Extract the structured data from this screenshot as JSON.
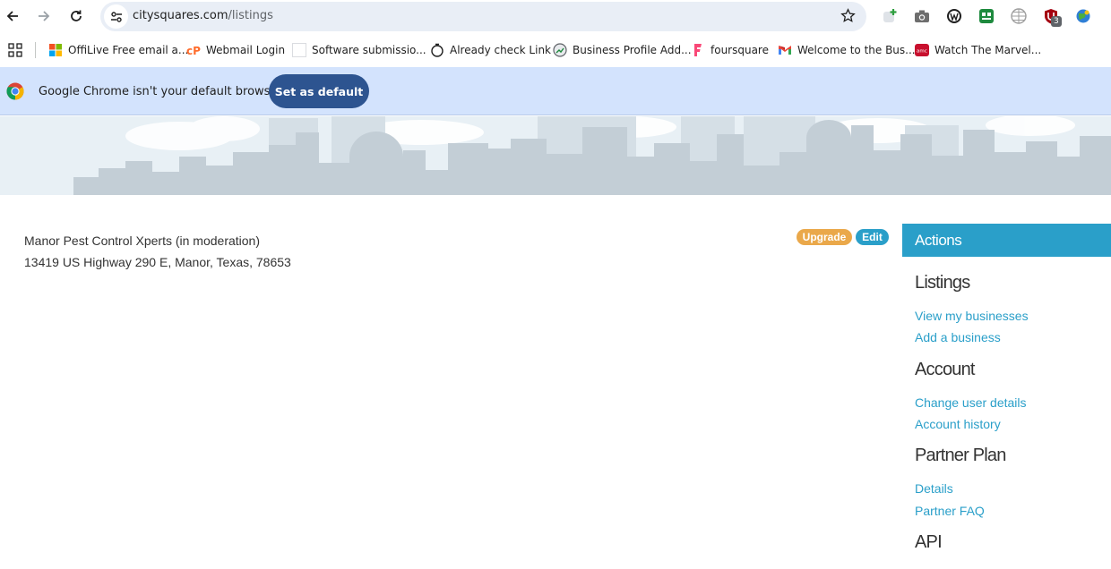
{
  "browser": {
    "url_host": "citysquares.com",
    "url_path": "/listings",
    "bookmarks": [
      {
        "label": "OffiLive Free email a...",
        "icon": "windows-logo-icon"
      },
      {
        "label": "Webmail Login",
        "icon": "cpanel-icon"
      },
      {
        "label": "Software submissio...",
        "icon": "blank-page-icon"
      },
      {
        "label": "Already check Link",
        "icon": "stopwatch-icon"
      },
      {
        "label": "Business Profile Add...",
        "icon": "globe-chart-icon"
      },
      {
        "label": "foursquare",
        "icon": "foursquare-icon"
      },
      {
        "label": "Welcome to the Bus...",
        "icon": "gmail-icon"
      },
      {
        "label": "Watch The Marvel...",
        "icon": "amc-icon"
      }
    ],
    "extension_badge": "3",
    "infobar": {
      "message": "Google Chrome isn't your default browser",
      "button": "Set as default"
    }
  },
  "listing": {
    "name": "Manor Pest Control Xperts (in moderation)",
    "address": "13419 US Highway 290 E, Manor, Texas, 78653",
    "upgrade_label": "Upgrade",
    "edit_label": "Edit"
  },
  "sidebar": {
    "header": "Actions",
    "sections": [
      {
        "title": "Listings",
        "links": [
          "View my businesses",
          "Add a business"
        ]
      },
      {
        "title": "Account",
        "links": [
          "Change user details",
          "Account history"
        ]
      },
      {
        "title": "Partner Plan",
        "links": [
          "Details",
          "Partner FAQ"
        ]
      },
      {
        "title": "API",
        "links": []
      }
    ]
  },
  "colors": {
    "accent": "#2a9fc9",
    "upgrade": "#eaa84a",
    "infobar": "#d3e3fd",
    "set_default_button": "#2d5490"
  }
}
